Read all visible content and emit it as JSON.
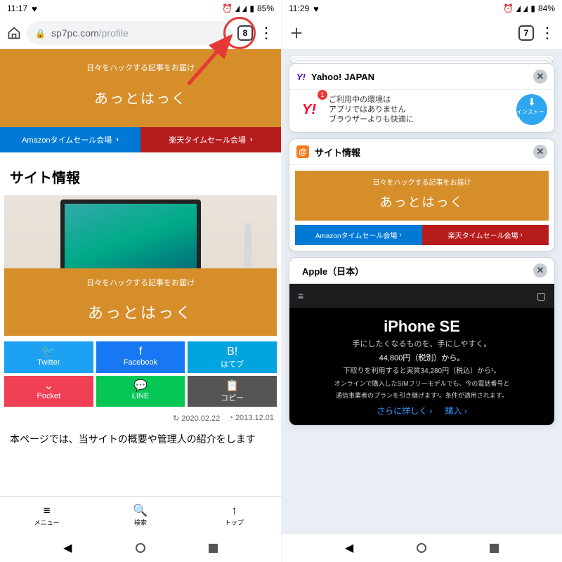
{
  "left": {
    "status": {
      "time": "11:17",
      "battery": "85%"
    },
    "url": {
      "host": "sp7pc.com",
      "path": "/profile"
    },
    "tabCount": "8",
    "hero": {
      "sub": "日々をハックする記事をお届け",
      "title": "あっとはっく"
    },
    "sale": {
      "amazon": "Amazonタイムセール会場",
      "rakuten": "楽天タイムセール会場"
    },
    "sectionTitle": "サイト情報",
    "photo": {
      "sub": "日々をハックする記事をお届け",
      "title": "あっとはっく"
    },
    "share": {
      "twitter": "Twitter",
      "facebook": "Facebook",
      "hatena": "はてブ",
      "pocket": "Pocket",
      "line": "LINE",
      "copy": "コピー"
    },
    "dates": {
      "updated": "2020.02.22",
      "created": "2013.12.01"
    },
    "body": "本ページでは、当サイトの概要や管理人の紹介をします",
    "bottomNav": {
      "menu": "メニュー",
      "search": "検索",
      "top": "トップ"
    }
  },
  "right": {
    "status": {
      "time": "11:29",
      "battery": "84%"
    },
    "tabCount": "7",
    "tabs": {
      "yahoo": {
        "title": "Yahoo! JAPAN",
        "msg1": "ご利用中の環境は",
        "msg2": "アプリではありません",
        "msg3": "ブラウザーよりも快適に",
        "install": "インストール",
        "badge": "1"
      },
      "sp": {
        "title": "サイト情報",
        "sub": "日々をハックする記事をお届け",
        "heroTitle": "あっとはっく",
        "saleA": "Amazonタイムセール会場",
        "saleR": "楽天タイムセール会場"
      },
      "apple": {
        "title": "Apple（日本）",
        "h": "iPhone SE",
        "p1": "手にしたくなるものを、手にしやすく。",
        "p2": "44,800円（税別）から。",
        "p3": "下取りを利用すると実質34,280円（税込）から¹。",
        "p4": "オンラインで購入したSIMフリーモデルでも、今の電話番号と",
        "p5": "通信事業者のプランを引き継げます²。条件が適用されます。",
        "link1": "さらに詳しく",
        "link2": "購入"
      }
    }
  }
}
